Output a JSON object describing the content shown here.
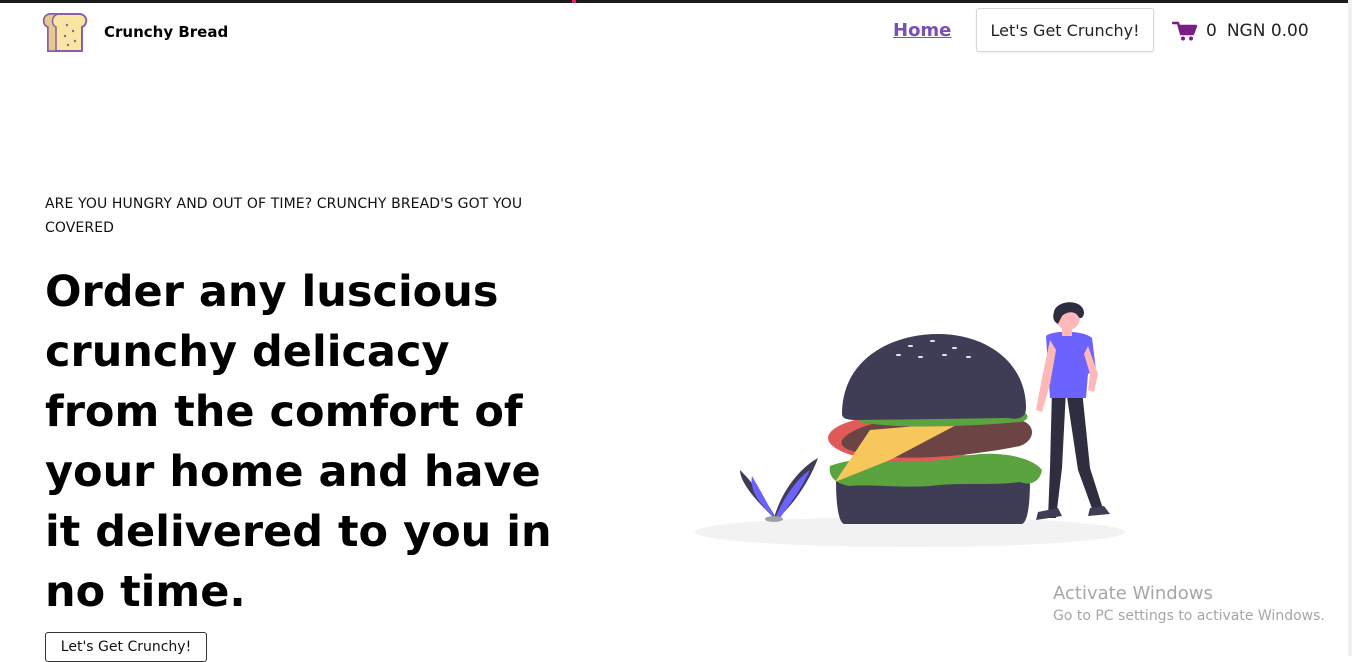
{
  "brand": {
    "name": "Crunchy Bread",
    "logo_icon": "bread-slice-icon"
  },
  "nav": {
    "home_label": "Home",
    "cta_label": "Let's Get Crunchy!",
    "cart": {
      "icon": "shopping-cart-icon",
      "count": "0",
      "total": "NGN 0.00"
    }
  },
  "hero": {
    "tagline": "ARE YOU HUNGRY AND OUT OF TIME? CRUNCHY BREAD'S GOT YOU COVERED",
    "headline": "Order any luscious crunchy delicacy from the comfort of your home and have it delivered to you in no time.",
    "button_label": "Let's Get Crunchy!"
  },
  "watermark": {
    "title": "Activate Windows",
    "subtitle": "Go to PC settings to activate Windows."
  },
  "colors": {
    "accent": "#7b4fb6",
    "cart": "#7a1d86",
    "bun": "#3f3d56",
    "lettuce": "#5aa33f",
    "cheese": "#f7c75b",
    "tomato": "#e05a5a",
    "shirt": "#6c63ff"
  }
}
